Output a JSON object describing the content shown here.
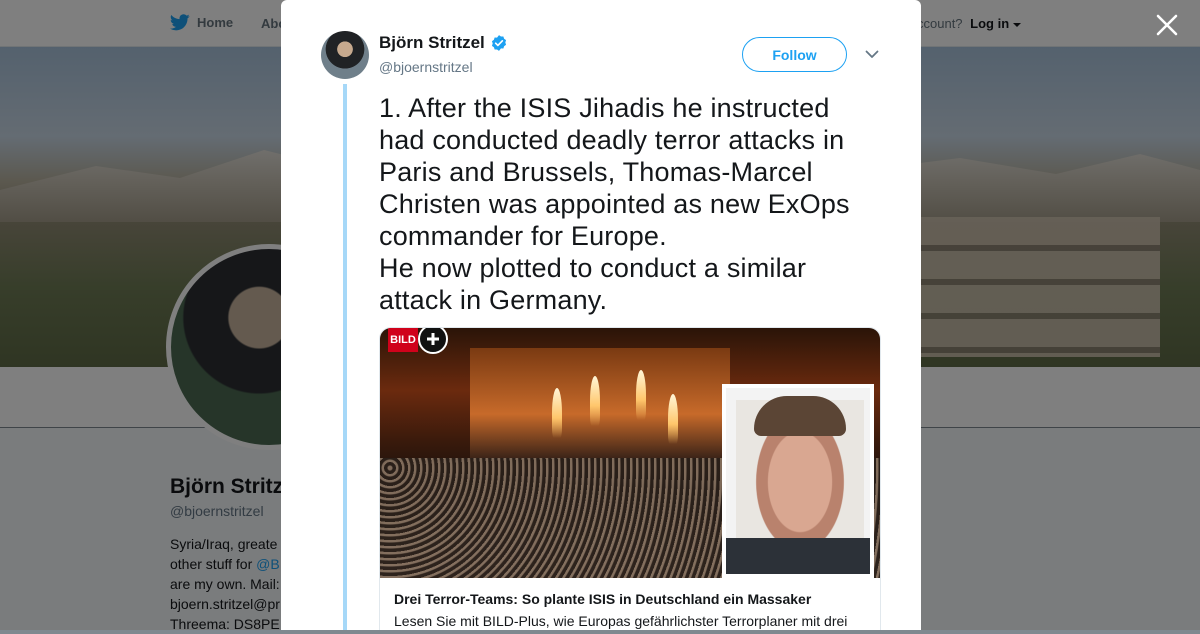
{
  "background": {
    "nav": {
      "home_label": "Home",
      "about_label": "Abo",
      "account_prompt": "ccount?",
      "login_label": "Log in"
    },
    "profile": {
      "name": "Björn Stritz",
      "handle": "@bjoernstritzel",
      "bio_lines": [
        "Syria/Iraq, greate",
        "other stuff for @B",
        "are my own. Mail:",
        "bjoern.stritzel@pr",
        "Threema: DS8PE"
      ]
    }
  },
  "modal": {
    "author": {
      "name": "Björn Stritzel",
      "handle": "@bjoernstritzel",
      "verified": true
    },
    "follow_label": "Follow",
    "tweet_text": "1. After the ISIS Jihadis he instructed had conducted deadly terror attacks in Paris and Brussels, Thomas-Marcel Christen was appointed as new ExOps commander for Europe.\nHe now plotted to conduct a similar attack in Germany.",
    "card": {
      "brand_label": "BILD",
      "title": "Drei Terror-Teams: So plante ISIS in Deutschland ein Massaker",
      "description": "Lesen Sie mit BILD-Plus, wie Europas gefährlichster Terrorplaner mit drei"
    }
  },
  "colors": {
    "accent": "#1da1f2",
    "thread_line": "#a6d8f8",
    "text": "#14171a",
    "muted": "#657786"
  },
  "icons": [
    "twitter-bird-icon",
    "verified-badge-icon",
    "chevron-down-icon",
    "close-icon",
    "plus-icon",
    "caret-down-icon"
  ]
}
